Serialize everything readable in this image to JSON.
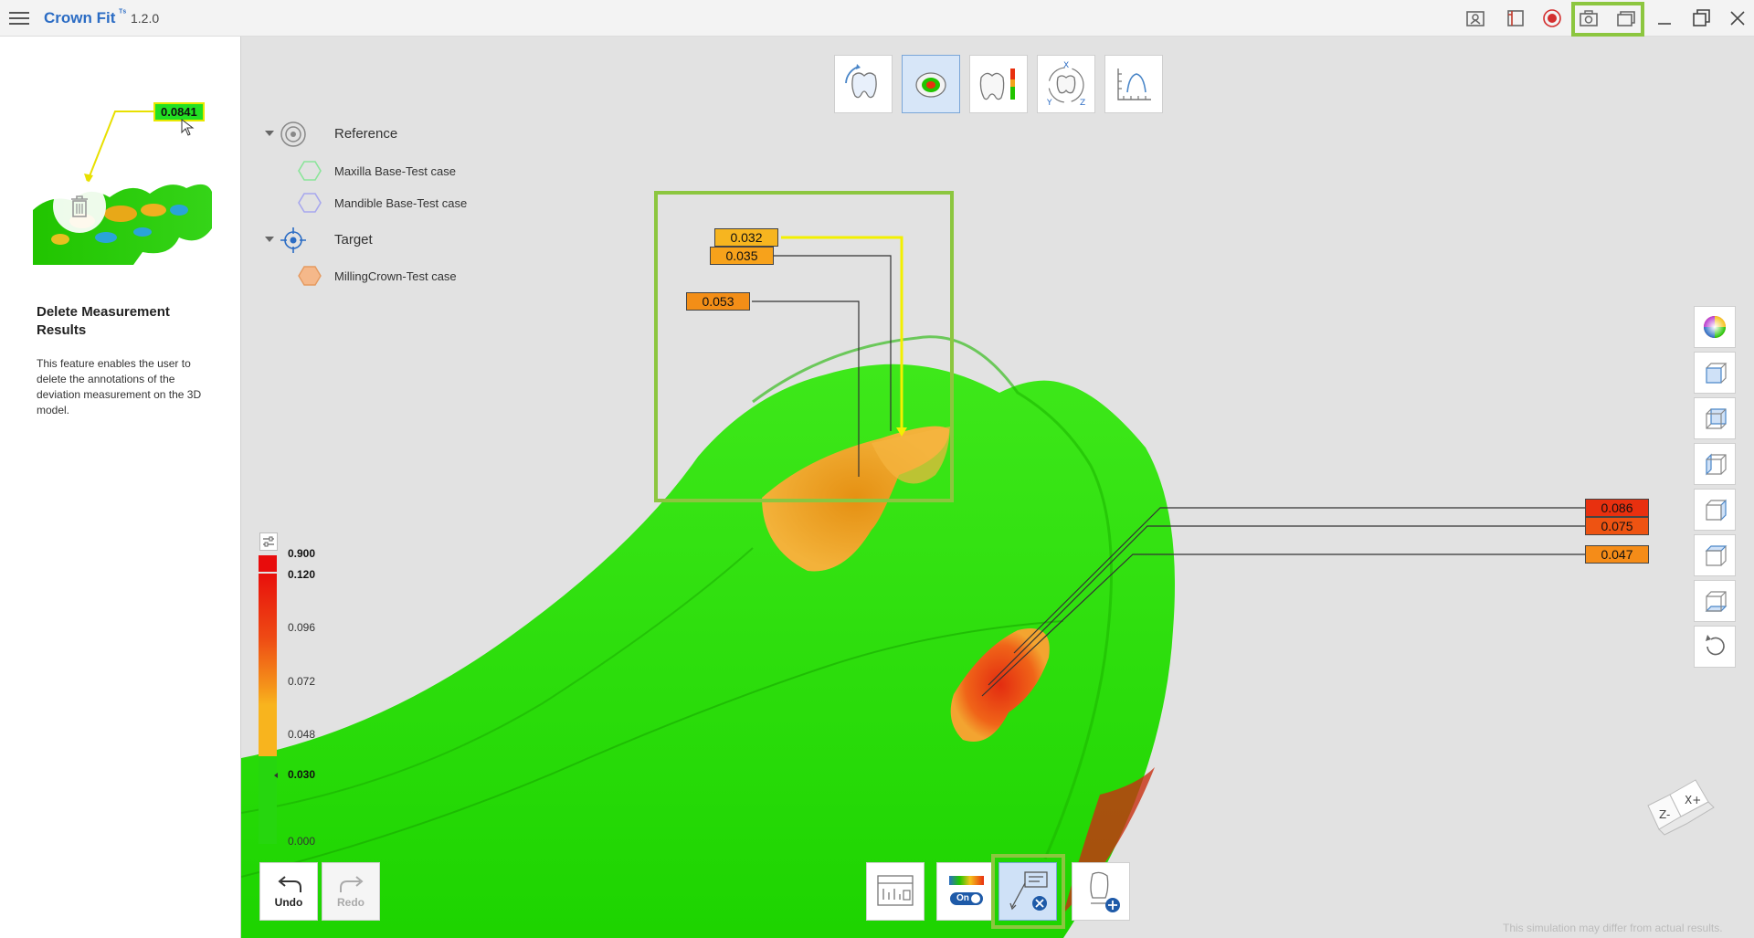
{
  "app": {
    "name": "Crown Fit",
    "badge": "ᵀˢ",
    "version": "1.2.0"
  },
  "left_panel": {
    "thumbnail_label": "0.0841",
    "title": "Delete Measurement Results",
    "description": "This feature enables the user to delete the annotations of the deviation measurement on the 3D model."
  },
  "tree": {
    "reference_label": "Reference",
    "reference_items": [
      "Maxilla Base-Test case",
      "Mandible Base-Test case"
    ],
    "target_label": "Target",
    "target_items": [
      "MillingCrown-Test case"
    ]
  },
  "measurements": {
    "left_group": [
      "0.032",
      "0.035",
      "0.053"
    ],
    "right_group": [
      "0.086",
      "0.075",
      "0.047"
    ]
  },
  "scale": {
    "values": [
      "0.900",
      "0.120",
      "0.096",
      "0.072",
      "0.048",
      "0.030",
      "0.000"
    ]
  },
  "history": {
    "undo_label": "Undo",
    "redo_label": "Redo"
  },
  "color_toggle": {
    "state_label": "On"
  },
  "footer_note": "This simulation may differ from actual results.",
  "colors": {
    "accent": "#2b6cc4",
    "highlight": "#8cc63f",
    "model_green": "#22e000",
    "deviation_orange": "#f7a21b",
    "deviation_red": "#e8200f"
  }
}
